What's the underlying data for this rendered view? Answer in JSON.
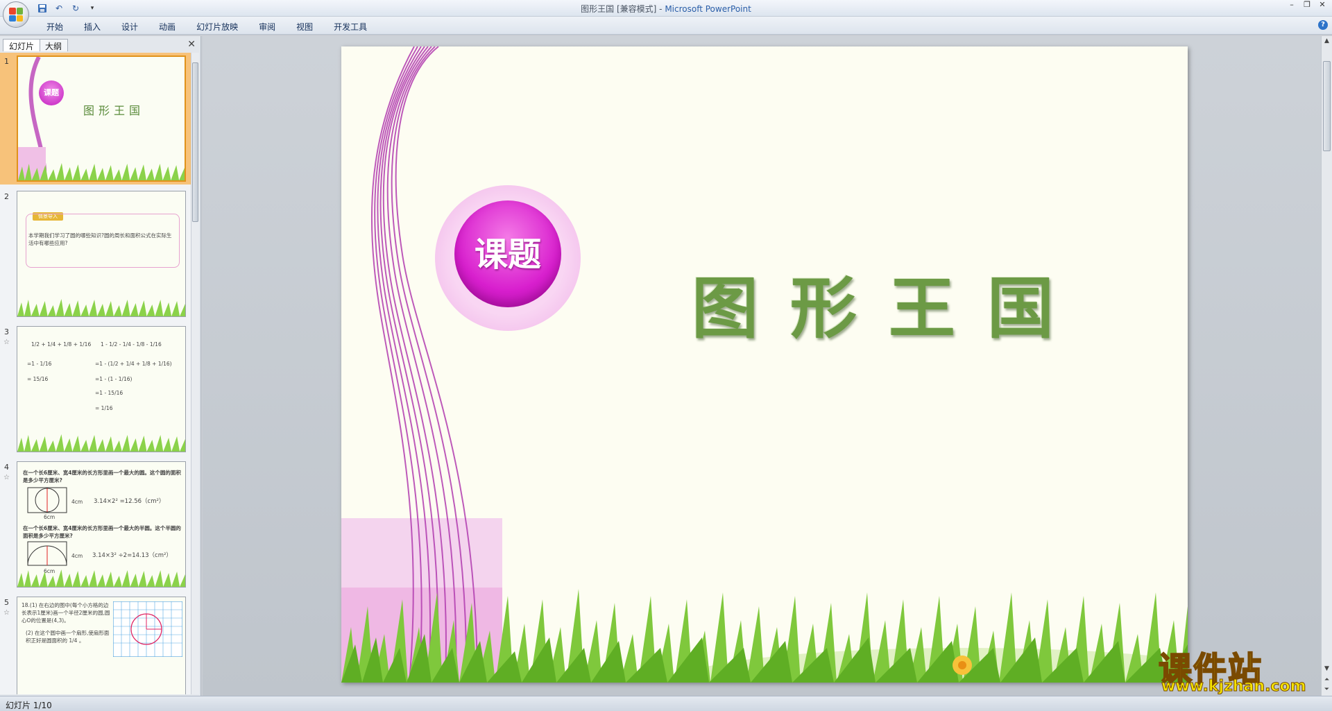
{
  "window": {
    "title": "图形王国 [兼容模式]",
    "separator": " - ",
    "app_name": "Microsoft PowerPoint"
  },
  "ribbon": {
    "tabs": [
      "开始",
      "插入",
      "设计",
      "动画",
      "幻灯片放映",
      "审阅",
      "视图",
      "开发工具"
    ]
  },
  "left_pane": {
    "tab_slides": "幻灯片",
    "tab_outline": "大纲",
    "slides": [
      {
        "num": "1",
        "title": "图形王国",
        "badge": "课题"
      },
      {
        "num": "2",
        "header": "情景导入",
        "text": "本学期我们学习了圆的哪些知识?圆的周长和面积公式在实际生活中有哪些应用?"
      },
      {
        "num": "3",
        "lines_left": [
          "1/2 + 1/4 + 1/8 + 1/16",
          "=1 - 1/16",
          "= 15/16"
        ],
        "lines_right": [
          "1 - 1/2 - 1/4 - 1/8 - 1/16",
          "=1 - (1/2 + 1/4 + 1/8 + 1/16)",
          "=1 - (1 - 1/16)",
          "=1 - 15/16",
          "= 1/16"
        ]
      },
      {
        "num": "4",
        "q1": "在一个长6厘米、宽4厘米的长方形里画一个最大的圆。这个圆的面积是多少平方厘米?",
        "a1": "3.14×2² =12.56（cm²）",
        "q2": "在一个长6厘米、宽4厘米的长方形里画一个最大的半圆。这个半圆的面积是多少平方厘米?",
        "a2": "3.14×3² ÷2=14.13（cm²）",
        "w": "6cm",
        "h": "4cm"
      },
      {
        "num": "5",
        "text1": "18.(1) 在右边的图中(每个小方格的边长表示1厘米)画一个半径2厘米的圆,圆心O的位置是(4,3)。",
        "text2": "(2) 在这个圆中画一个扇形,使扇形面积正好是圆面积的 1/4 。"
      }
    ]
  },
  "slide": {
    "badge": "课题",
    "title": "图形王国"
  },
  "status": {
    "slide_counter": "幻灯片 1/10"
  },
  "watermark": {
    "brand": "课件站",
    "url": "www.kjzhan.com"
  },
  "colors": {
    "accent_magenta": "#d81fce",
    "title_green": "#6c9a45",
    "selection_orange": "#f7c27a"
  }
}
